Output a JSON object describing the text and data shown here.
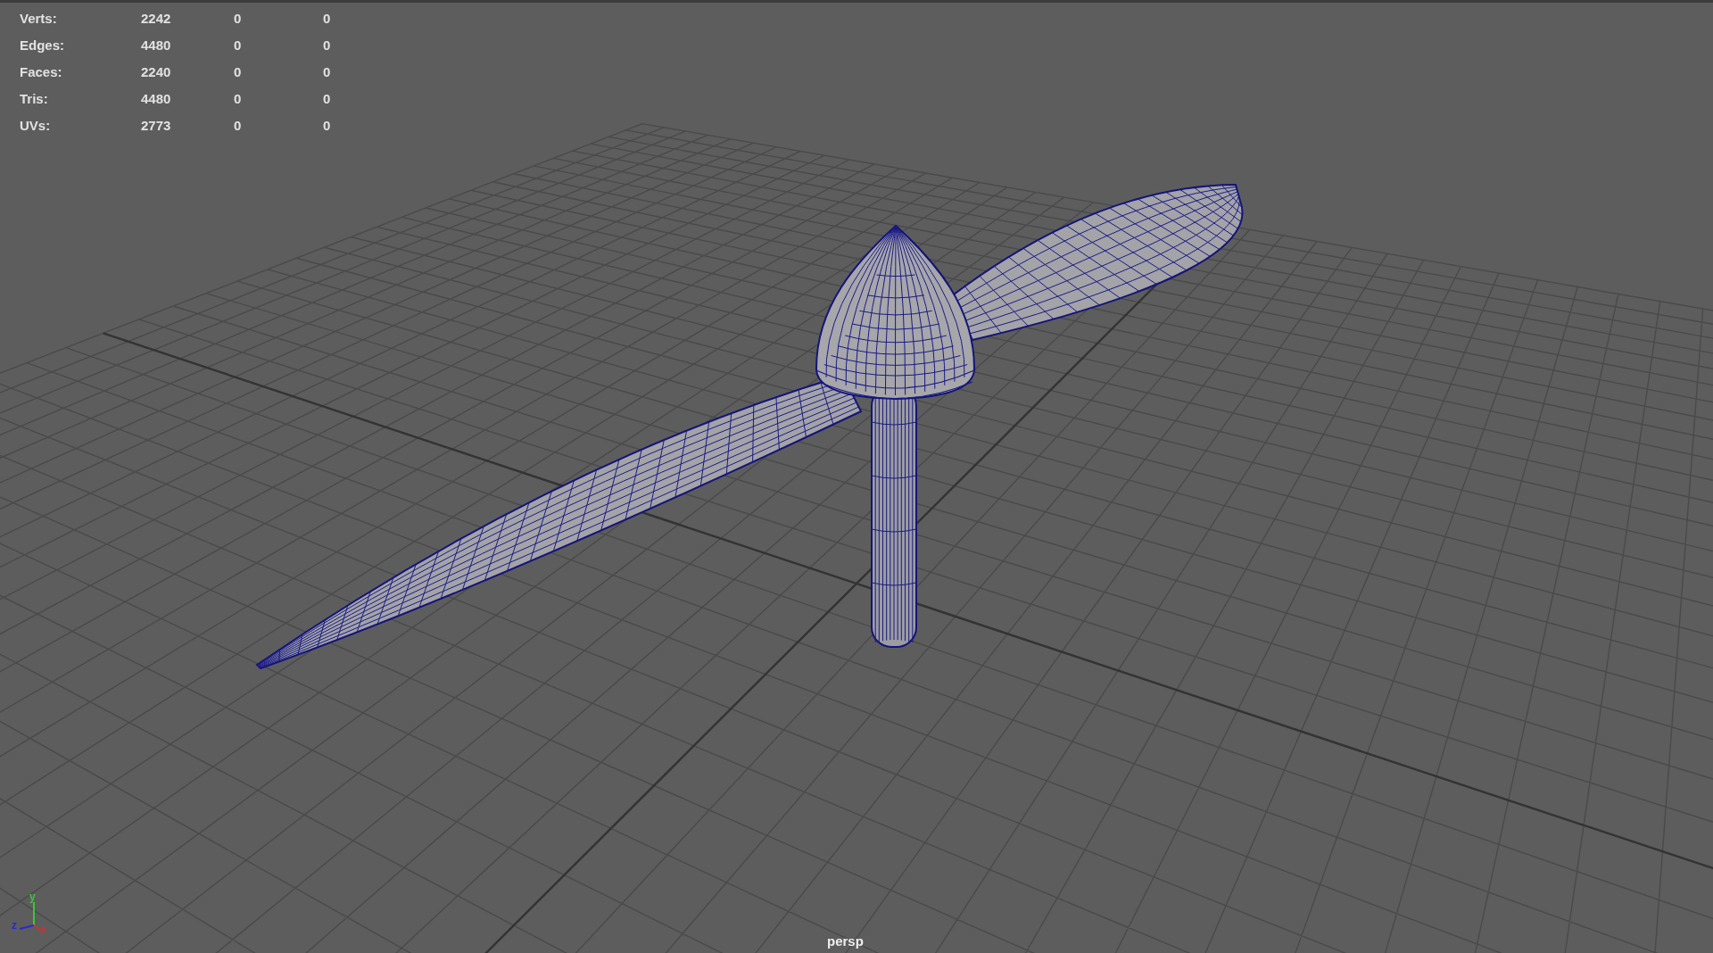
{
  "hud": {
    "rows": [
      {
        "label": "Verts:",
        "values": [
          "2242",
          "0",
          "0"
        ]
      },
      {
        "label": "Edges:",
        "values": [
          "4480",
          "0",
          "0"
        ]
      },
      {
        "label": "Faces:",
        "values": [
          "2240",
          "0",
          "0"
        ]
      },
      {
        "label": "Tris:",
        "values": [
          "4480",
          "0",
          "0"
        ]
      },
      {
        "label": "UVs:",
        "values": [
          "2773",
          "0",
          "0"
        ]
      }
    ]
  },
  "axis_gizmo": {
    "x": "x",
    "y": "y",
    "z": "z"
  },
  "camera_label": "persp"
}
